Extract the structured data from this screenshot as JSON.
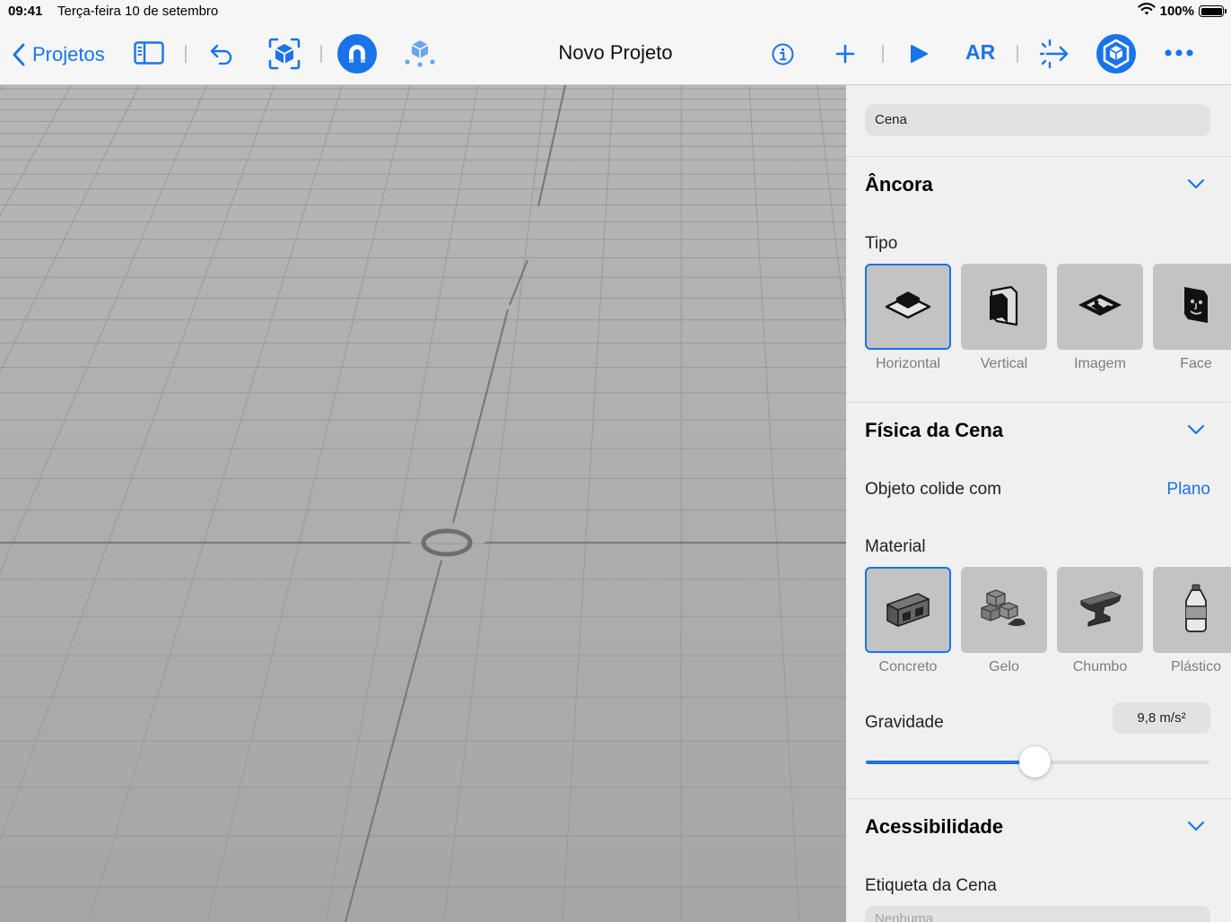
{
  "status_bar": {
    "time": "09:41",
    "date": "Terça-feira 10 de setembro",
    "battery": "100%"
  },
  "toolbar": {
    "back_label": "Projetos",
    "title": "Novo Projeto",
    "ar_label": "AR",
    "icons": [
      "chevron-left-icon",
      "sidebar-icon",
      "undo-icon",
      "object-scan-icon",
      "snap-magnet-icon",
      "add-anchor-icon",
      "info-icon",
      "plus-icon",
      "play-icon",
      "transform-arrow-icon",
      "scene-settings-icon",
      "more-icon"
    ]
  },
  "colors": {
    "accent": "#1a73e8",
    "panel_bg": "#f0f0f0",
    "viewport_grid": "#a9a9a9"
  },
  "inspector": {
    "scene_label": "Cena",
    "anchor": {
      "title": "Âncora",
      "type_label": "Tipo",
      "types": [
        {
          "label": "Horizontal",
          "icon": "horizontal-plane-icon",
          "selected": true
        },
        {
          "label": "Vertical",
          "icon": "vertical-plane-icon",
          "selected": false
        },
        {
          "label": "Imagem",
          "icon": "image-anchor-icon",
          "selected": false
        },
        {
          "label": "Face",
          "icon": "face-anchor-icon",
          "selected": false
        }
      ]
    },
    "physics": {
      "title": "Física da Cena",
      "collides_label": "Objeto colide com",
      "collides_value": "Plano",
      "material_label": "Material",
      "materials": [
        {
          "label": "Concreto",
          "icon": "concrete-block-icon",
          "selected": true
        },
        {
          "label": "Gelo",
          "icon": "ice-cubes-icon",
          "selected": false
        },
        {
          "label": "Chumbo",
          "icon": "lead-anvil-icon",
          "selected": false
        },
        {
          "label": "Plástico",
          "icon": "plastic-bottle-icon",
          "selected": false
        }
      ],
      "gravity_label": "Gravidade",
      "gravity_value": "9,8 m/s²",
      "gravity_slider_fraction": 0.49
    },
    "accessibility": {
      "title": "Acessibilidade",
      "scene_tag_label": "Etiqueta da Cena",
      "scene_tag_placeholder": "Nenhuma"
    }
  }
}
